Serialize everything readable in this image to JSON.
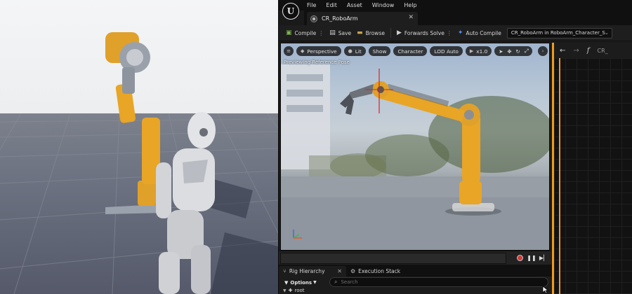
{
  "app": {
    "logo_letter": "U",
    "menu": [
      "File",
      "Edit",
      "Asset",
      "Window",
      "Help"
    ],
    "document_tab": {
      "label": "CR_RoboArm"
    }
  },
  "toolbar": {
    "compile_label": "Compile",
    "save_label": "Save",
    "browse_label": "Browse",
    "forwards_solve_label": "Forwards Solve",
    "auto_compile_label": "Auto Compile",
    "debug_target": "CR_RoboArm in RoboArm_Character_S"
  },
  "viewport": {
    "perspective_label": "Perspective",
    "lit_label": "Lit",
    "show_label": "Show",
    "character_label": "Character",
    "lod_label": "LOD Auto",
    "speed_label": "x1.0",
    "overlay_text": "Previewing Reference Pose"
  },
  "graph": {
    "title_text": "CR_"
  },
  "panels": {
    "tabs": [
      "Rig Hierarchy",
      "Execution Stack"
    ],
    "options_label": "Options",
    "search_placeholder": "Search",
    "tree_root": "root"
  },
  "colors": {
    "accent_orange": "#f09a1d",
    "robot_yellow": "#e8a526",
    "mannequin": "#d9dadd",
    "record_red": "#d23a3a"
  }
}
